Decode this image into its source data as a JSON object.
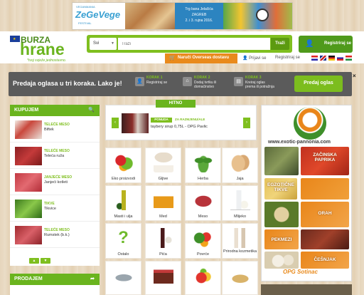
{
  "banner": {
    "brand_small": "VEGANMANIA",
    "brand": "ZeGeVege",
    "brand_sub": "FESTIVAL",
    "location": "Trg bana Jelačića",
    "city": "ZAGREB",
    "dates": "2. i 3. rujna 2016."
  },
  "header": {
    "logo_top": "BURZA",
    "logo_main": "hrane",
    "tagline": "*tvoj svježe jednostavno.",
    "search": {
      "select_value": "Svi",
      "placeholder": "Traži",
      "button": "Traži"
    },
    "register_button": "Registriraj se",
    "overseas_button": "Naruči Overseas dostavu",
    "login_link": "Prijavi se",
    "register_link": "Registriraj se"
  },
  "steps": {
    "title": "Predaja oglasa u tri koraka. Lako je!",
    "items": [
      {
        "label": "KORAK 1",
        "text": "Registriraj se"
      },
      {
        "label": "KORAK 2",
        "text1": "Dodaj tvrtku ili",
        "text2": "domaćinstvo"
      },
      {
        "label": "KORAK 3",
        "text1": "Kreiraj oglas",
        "text2": "prema ili potražnja"
      }
    ],
    "button": "Predaj oglas",
    "close": "×"
  },
  "kupujem": {
    "title": "KUPUJEM",
    "items": [
      {
        "cat": "TELEĆE MESO",
        "name": "Biftek"
      },
      {
        "cat": "TELEĆE MESO",
        "name": "Teleća ruža"
      },
      {
        "cat": "JANJEĆE MESO",
        "name": "Janjeći kotleti"
      },
      {
        "cat": "TIKVE",
        "name": "Tikvice"
      },
      {
        "cat": "TELEĆE MESO",
        "name": "Rumstek (b.k.)"
      }
    ],
    "prev": "▲",
    "next": "▼"
  },
  "prodajem": {
    "title": "PRODAJEM"
  },
  "hitno": {
    "tab": "HITNO",
    "badge": "PONUDA",
    "badge2": "ZA RAZMJENU/ALE",
    "title": "taybery sirup 0,75L - OPG Pavlic",
    "prev": "‹",
    "next": "›"
  },
  "categories": [
    "Eko proizvodi",
    "Gljive",
    "Herba",
    "Jaja",
    "Masti i ulja",
    "Med",
    "Meso",
    "Mlijeko",
    "Ostalo",
    "Pića",
    "Povrće",
    "Prirodna kozmetika",
    "",
    "",
    "",
    ""
  ],
  "right_ad": {
    "url": "www.exotic-pannonia.com",
    "labels": [
      "ZAČINSKA PAPRIKA",
      "EGZOTIČNE TIKVE",
      "ORAH",
      "PEKMEZI",
      "ČEŠNJAK"
    ],
    "signature": "OPG Sotinac"
  },
  "colors": {
    "green": "#6ab41e",
    "dark_green": "#4f9a1b",
    "orange": "#e98a1c",
    "gray_bar": "#5b5b5b"
  }
}
